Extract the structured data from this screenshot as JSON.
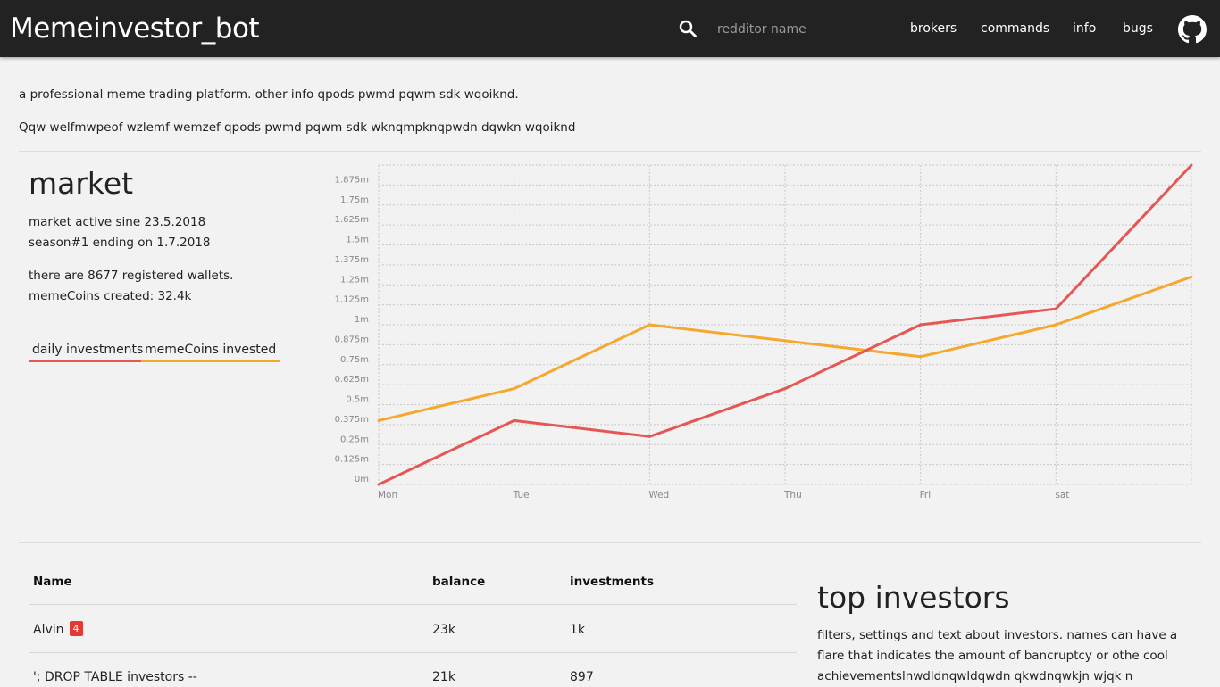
{
  "header": {
    "brand": "Memeinvestor_bot",
    "search_placeholder": "redditor name",
    "nav": [
      "brokers",
      "commands",
      "info",
      "bugs"
    ],
    "github_icon": "github-icon",
    "search_icon": "search-icon"
  },
  "intro": {
    "line1": "a professional meme trading platform. other info qpods pwmd pqwm sdk wqoiknd.",
    "line2": "Qqw welfmwpeof wzlemf wemzef qpods pwmd pqwm sdk wknqmpknqpwdn dqwkn wqoiknd"
  },
  "market": {
    "title": "market",
    "active_since": "market active sine 23.5.2018",
    "season": "season#1 ending on 1.7.2018",
    "wallets": "there are 8677 registered wallets. memeCoins created: 32.4k",
    "legend": [
      {
        "label": "daily investments",
        "color": "#e55753"
      },
      {
        "label": "memeCoins invested",
        "color": "#f6a72d"
      }
    ]
  },
  "chart_data": {
    "type": "line",
    "x": [
      "Mon",
      "Tue",
      "Wed",
      "Thu",
      "Fri",
      "sat",
      ""
    ],
    "y_ticks": [
      "0m",
      "0.125m",
      "0.25m",
      "0.375m",
      "0.5m",
      "0.625m",
      "0.75m",
      "0.875m",
      "1m",
      "1.125m",
      "1.25m",
      "1.375m",
      "1.5m",
      "1.625m",
      "1.75m",
      "1.875m"
    ],
    "ylim": [
      0,
      2
    ],
    "grid": true,
    "series": [
      {
        "name": "daily investments",
        "color": "#e55753",
        "values": [
          0,
          0.4,
          0.3,
          0.6,
          1.0,
          1.1,
          2.0
        ]
      },
      {
        "name": "memeCoins invested",
        "color": "#f6a72d",
        "values": [
          0.4,
          0.6,
          1.0,
          0.9,
          0.8,
          1.0,
          1.3
        ]
      }
    ]
  },
  "table": {
    "headers": [
      "Name",
      "balance",
      "investments"
    ],
    "rows": [
      {
        "name": "Alvin",
        "badge": "4",
        "balance": "23k",
        "investments": "1k"
      },
      {
        "name": "'; DROP TABLE investors --",
        "badge": "",
        "balance": "21k",
        "investments": "897"
      }
    ]
  },
  "top_investors": {
    "title": "top investors",
    "text": "filters, settings and text about investors. names can have a flare that indicates the amount of bancruptcy or othe cool achievementslnwdldnqwldqwdn qkwdnqwkjn wjqk n"
  }
}
